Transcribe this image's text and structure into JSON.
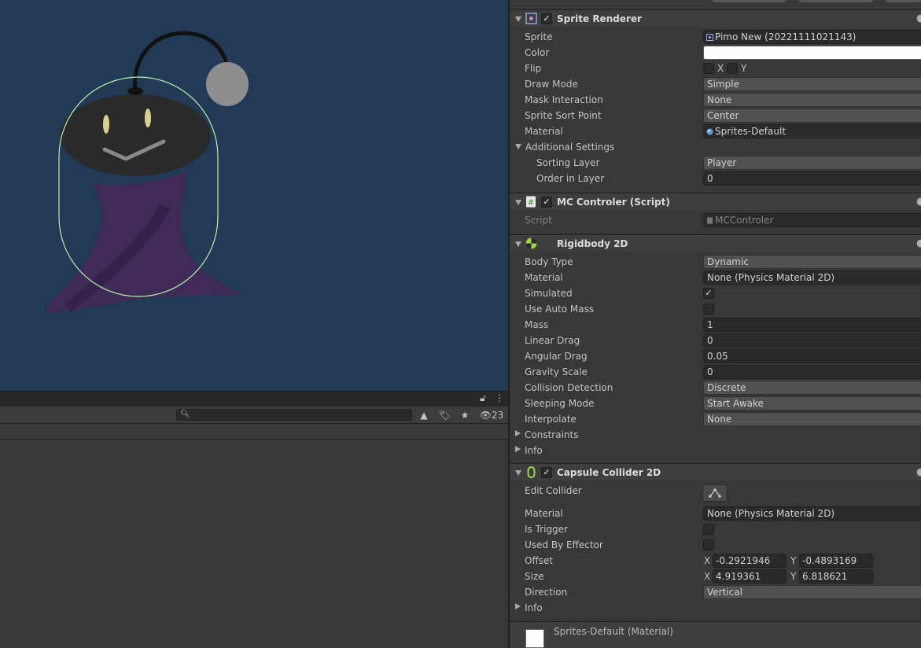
{
  "scene": {
    "background": "#223a55"
  },
  "project_panel": {
    "hidden_count": "23",
    "search_placeholder": ""
  },
  "inspector": {
    "sprite_renderer": {
      "title": "Sprite Renderer",
      "enabled": true,
      "rows": {
        "sprite": {
          "label": "Sprite",
          "value": "Pimo New (20221111021143)"
        },
        "color": {
          "label": "Color",
          "value": "#ffffff"
        },
        "flip": {
          "label": "Flip",
          "x": "X",
          "y": "Y"
        },
        "draw_mode": {
          "label": "Draw Mode",
          "value": "Simple"
        },
        "mask_interaction": {
          "label": "Mask Interaction",
          "value": "None"
        },
        "sprite_sort_point": {
          "label": "Sprite Sort Point",
          "value": "Center"
        },
        "material": {
          "label": "Material",
          "value": "Sprites-Default"
        },
        "additional_settings": {
          "label": "Additional Settings"
        },
        "sorting_layer": {
          "label": "Sorting Layer",
          "value": "Player"
        },
        "order_in_layer": {
          "label": "Order in Layer",
          "value": "0"
        }
      }
    },
    "mc_controler": {
      "title": "MC Controler (Script)",
      "enabled": true,
      "script": {
        "label": "Script",
        "value": "MCControler"
      }
    },
    "rigidbody": {
      "title": "Rigidbody 2D",
      "rows": {
        "body_type": {
          "label": "Body Type",
          "value": "Dynamic"
        },
        "material": {
          "label": "Material",
          "value": "None (Physics Material 2D)"
        },
        "simulated": {
          "label": "Simulated",
          "checked": true
        },
        "use_auto_mass": {
          "label": "Use Auto Mass",
          "checked": false
        },
        "mass": {
          "label": "Mass",
          "value": "1"
        },
        "linear_drag": {
          "label": "Linear Drag",
          "value": "0"
        },
        "angular_drag": {
          "label": "Angular Drag",
          "value": "0.05"
        },
        "gravity_scale": {
          "label": "Gravity Scale",
          "value": "0"
        },
        "collision_detection": {
          "label": "Collision Detection",
          "value": "Discrete"
        },
        "sleeping_mode": {
          "label": "Sleeping Mode",
          "value": "Start Awake"
        },
        "interpolate": {
          "label": "Interpolate",
          "value": "None"
        },
        "constraints": {
          "label": "Constraints"
        },
        "info": {
          "label": "Info"
        }
      }
    },
    "capsule_collider": {
      "title": "Capsule Collider 2D",
      "enabled": true,
      "rows": {
        "edit_collider": {
          "label": "Edit Collider"
        },
        "material": {
          "label": "Material",
          "value": "None (Physics Material 2D)"
        },
        "is_trigger": {
          "label": "Is Trigger",
          "checked": false
        },
        "used_by_effector": {
          "label": "Used By Effector",
          "checked": false
        },
        "offset": {
          "label": "Offset",
          "x_label": "X",
          "x": "-0.2921946",
          "y_label": "Y",
          "y": "-0.4893169"
        },
        "size": {
          "label": "Size",
          "x_label": "X",
          "x": "4.919361",
          "y_label": "Y",
          "y": "6.818621"
        },
        "direction": {
          "label": "Direction",
          "value": "Vertical"
        },
        "info": {
          "label": "Info"
        }
      }
    },
    "material_footer": {
      "title": "Sprites-Default (Material)"
    }
  }
}
